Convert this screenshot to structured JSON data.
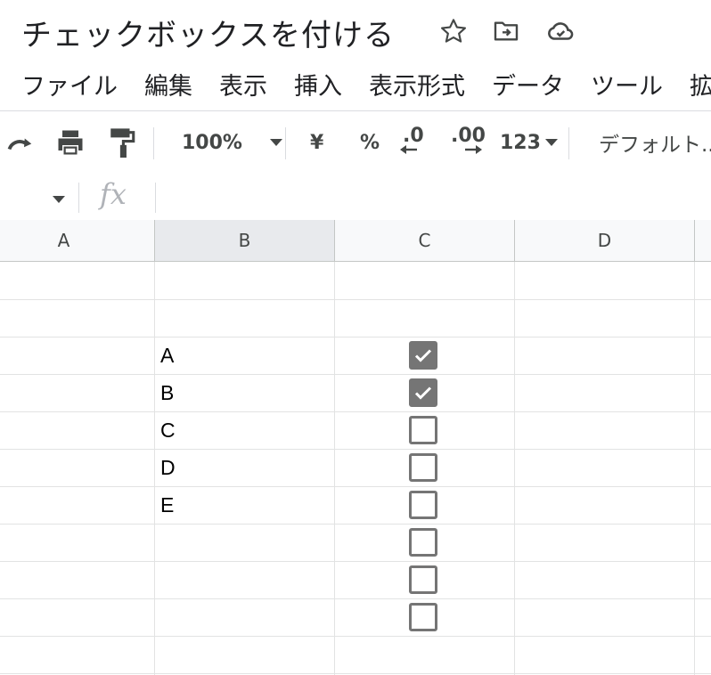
{
  "title": "チェックボックスを付ける",
  "title_icons": [
    "star-icon",
    "move-to-folder-icon",
    "cloud-saved-icon"
  ],
  "menu": [
    "ファイル",
    "編集",
    "表示",
    "挿入",
    "表示形式",
    "データ",
    "ツール",
    "拡"
  ],
  "toolbar": {
    "zoom": "100%",
    "currency": "¥",
    "percent": "%",
    "decrease_decimal": ".0",
    "increase_decimal": ".00",
    "number_format": "123",
    "font": "デフォルト..."
  },
  "formula_bar": {
    "fx": "fx",
    "value": ""
  },
  "columns": [
    "A",
    "B",
    "C",
    "D"
  ],
  "rows": [
    {
      "b": "",
      "checkbox": null
    },
    {
      "b": "",
      "checkbox": null
    },
    {
      "b": "A",
      "checkbox": true
    },
    {
      "b": "B",
      "checkbox": true
    },
    {
      "b": "C",
      "checkbox": false
    },
    {
      "b": "D",
      "checkbox": false
    },
    {
      "b": "E",
      "checkbox": false
    },
    {
      "b": "",
      "checkbox": false
    },
    {
      "b": "",
      "checkbox": false
    },
    {
      "b": "",
      "checkbox": false
    },
    {
      "b": "",
      "checkbox": null
    }
  ],
  "colors": {
    "checkbox": "#757575",
    "header_bg": "#f8f9fa",
    "selected_header_bg": "#e8eaed"
  }
}
